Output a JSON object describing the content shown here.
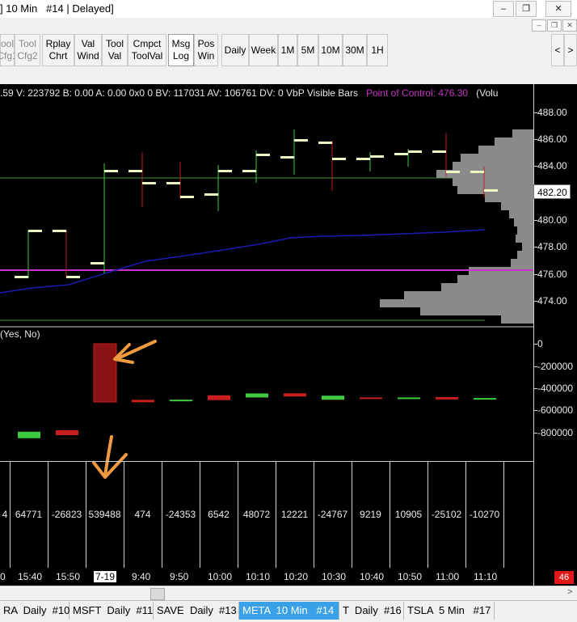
{
  "window": {
    "title": "] 10 Min   #14 | Delayed]",
    "minimize": "–",
    "restore": "❐",
    "close": "✕"
  },
  "toolbar": {
    "buttons": [
      {
        "label": "ool\nCfg1"
      },
      {
        "label": "Tool\nCfg2"
      },
      {
        "label": "Rplay\nChrt"
      },
      {
        "label": "Val\nWind"
      },
      {
        "label": "Tool\nVal"
      },
      {
        "label": "Cmpct\nToolVal"
      },
      {
        "label": "Msg\nLog"
      },
      {
        "label": "Pos\nWin"
      }
    ],
    "timeframes": [
      "Daily",
      "Week",
      "1M",
      "5M",
      "10M",
      "30M",
      "1H"
    ],
    "nav_left": "<",
    "nav_right": ">"
  },
  "chart": {
    "info_text": ".59 V: 223792 B: 0.00 A: 0.00 0x0 0 BV: 117031 AV: 106761 DV: 0 VbP Visible Bars",
    "point_of_control": "Point of Control: 476.30",
    "vol_label": "(Volu",
    "price_axis": [
      "488.00",
      "486.00",
      "484.00",
      "482.20",
      "480.00",
      "478.00",
      "476.00",
      "474.00"
    ],
    "current_price": "482.20",
    "study_title": "(Yes, No)",
    "study_axis": [
      "0",
      "-200000",
      "-400000",
      "-600000",
      "-800000"
    ],
    "colors": {
      "up": "#3fc93f",
      "down": "#c81e1e",
      "poc": "#c832c8",
      "ma": "#1a1ab0",
      "level": "#3d9a3d",
      "arrow": "#f09a40"
    }
  },
  "chart_data": {
    "type": "bar",
    "categories": [
      "",
      "15:40",
      "15:50",
      "7-19",
      "9:40",
      "9:50",
      "10:00",
      "10:10",
      "10:20",
      "10:30",
      "10:40",
      "10:50",
      "11:00",
      "11:10"
    ],
    "values": [
      null,
      64771,
      -26823,
      539488,
      474,
      -24353,
      6542,
      48072,
      12221,
      -24767,
      9219,
      10905,
      -25102,
      -10270
    ],
    "first_value_partial": "4",
    "xlabel": "",
    "ylabel": ""
  },
  "axis": {
    "leftmost_label": "0",
    "highlight_label": "7-19",
    "counter": "46"
  },
  "scroll": {
    "left": "<",
    "right": ">"
  },
  "tabs": [
    {
      "label": "RA  Daily  #10"
    },
    {
      "label": "MSFT  Daily  #11"
    },
    {
      "label": "SAVE  Daily  #13"
    },
    {
      "label": "META  10 Min   #14",
      "active": true
    },
    {
      "label": "T  Daily  #16"
    },
    {
      "label": "TSLA  5 Min   #17"
    }
  ]
}
